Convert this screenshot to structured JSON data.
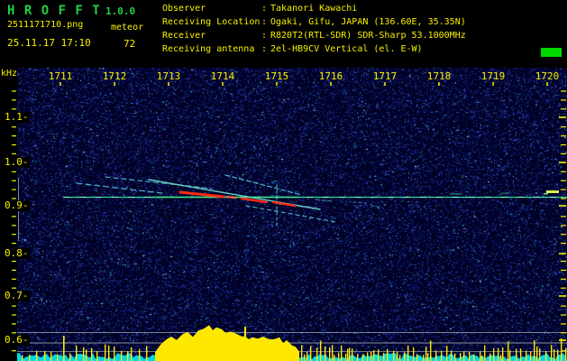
{
  "header": {
    "app_title": "H R O F F T",
    "version": "1.0.0",
    "filename": "2511171710.png",
    "mode": "meteor",
    "datetime": "25.11.17 17:10",
    "echo_count": "72",
    "colon": ":",
    "info_rows": [
      {
        "label": "Observer",
        "value": "Takanori Kawachi"
      },
      {
        "label": "Receiving Location",
        "value": "Ogaki, Gifu, JAPAN (136.60E, 35.35N)"
      },
      {
        "label": "Receiver",
        "value": "R820T2(RTL-SDR) SDR-Sharp 53.1000MHz"
      },
      {
        "label": "Receiving antenna",
        "value": "2el-HB9CV Vertical (el. E-W)"
      }
    ]
  },
  "axes": {
    "freq_unit_label": "kHz",
    "freq_tick_labels": [
      "1.1",
      "1.0",
      "0.9",
      "0.8",
      "0.7",
      "0.6"
    ],
    "time_tick_labels": [
      "1711",
      "1712",
      "1713",
      "1714",
      "1715",
      "1716",
      "1717",
      "1718",
      "1719",
      "1720"
    ]
  },
  "colors": {
    "title_green": "#22d044",
    "text_yellow": "#f8f000",
    "indicator_green": "#00d800",
    "field_navy": "#000024",
    "noise_blue": "#2438c8",
    "noise_cyan": "#1ec0d4",
    "carrier_green": "#2fe39c",
    "echo_cyan": "#55d2e8",
    "echo_red": "#ff2a14",
    "ref_line_gray": "#9aa3ad",
    "graph_cyan": "#00e4ee",
    "graph_yellow": "#ffe800"
  }
}
